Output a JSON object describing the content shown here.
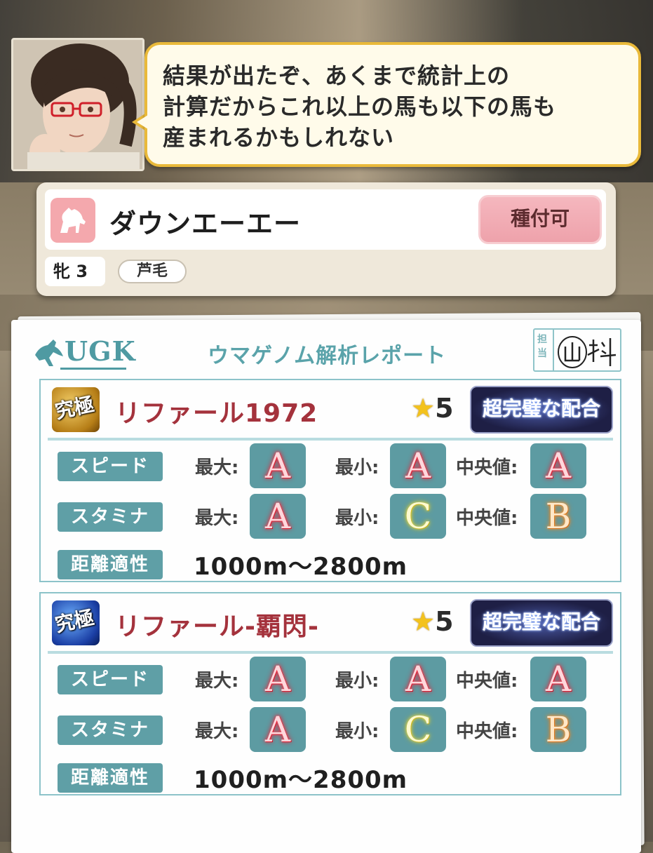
{
  "dialog": {
    "lines": [
      "結果が出たぞ、あくまで統計上の",
      "計算だからこれ以上の馬も以下の馬も",
      "産まれるかもしれない"
    ]
  },
  "horse": {
    "name": "ダウンエーエー",
    "breed_button": "種付可",
    "sex_age": "牝 3",
    "coat": "芦毛",
    "icon": "horse-silhouette-icon"
  },
  "report": {
    "logo": "UGK",
    "title": "ウマゲノム解析レポート",
    "stamp_label": "担当",
    "stamp_sign": "山科"
  },
  "labels": {
    "speed": "スピード",
    "stamina": "スタミナ",
    "distance": "距離適性",
    "max": "最大:",
    "min": "最小:",
    "median": "中央値:"
  },
  "sires": [
    {
      "name": "リファール1972",
      "icon_kanji": "究極",
      "stars": "5",
      "match": "超完璧な配合",
      "speed": {
        "max": "A",
        "min": "A",
        "median": "A"
      },
      "stamina": {
        "max": "A",
        "min": "C",
        "median": "B"
      },
      "distance": "1000m〜2800m"
    },
    {
      "name": "リファール-覇閃-",
      "icon_kanji": "究極",
      "stars": "5",
      "match": "超完璧な配合",
      "speed": {
        "max": "A",
        "min": "A",
        "median": "A"
      },
      "stamina": {
        "max": "A",
        "min": "C",
        "median": "B"
      },
      "distance": "1000m〜2800m"
    }
  ],
  "colors": {
    "bubble_border": "#e9b93a",
    "accent_teal": "#5f9fa6",
    "sire_name": "#a4323c",
    "breed_button": "#f5b7be"
  }
}
